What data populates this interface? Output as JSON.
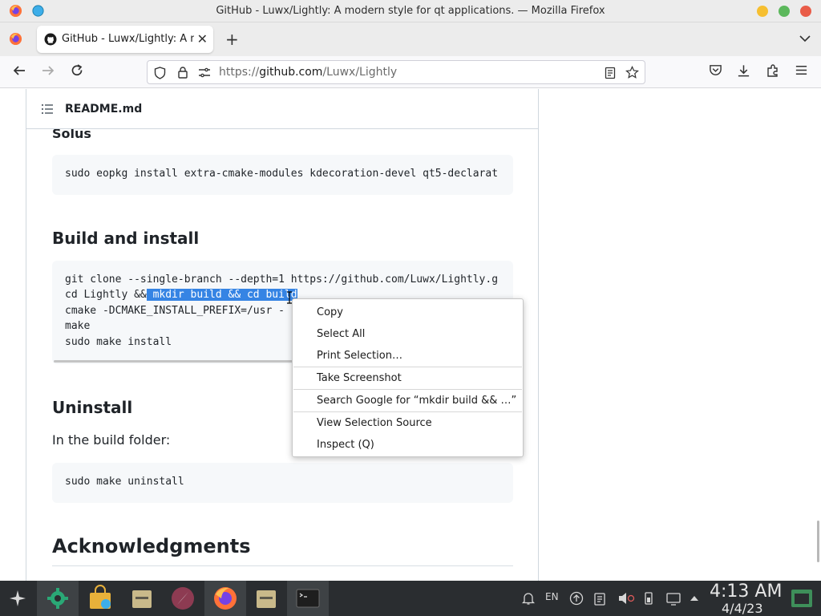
{
  "window": {
    "title": "GitHub - Luwx/Lightly: A modern style for qt applications. — Mozilla Firefox"
  },
  "tabs": [
    {
      "label": "GitHub - Luwx/Lightly: A m",
      "active": true
    }
  ],
  "navbar": {
    "url_prefix": "https://",
    "url_domain": "github.com",
    "url_path": "/Luwx/Lightly"
  },
  "readme": {
    "filename": "README.md",
    "solus_heading": "Solus",
    "solus_code": "sudo eopkg install extra-cmake-modules kdecoration-devel qt5-declarat",
    "build_heading": "Build and install",
    "build_code": {
      "line1": "git clone --single-branch --depth=1 https://github.com/Luwx/Lightly.g",
      "line2_pre": "cd Lightly &&",
      "line2_sel": " mkdir build && cd build",
      "line3": "cmake -DCMAKE_INSTALL_PREFIX=/usr -",
      "line4": "make",
      "line5": "sudo make install"
    },
    "uninstall_heading": "Uninstall",
    "uninstall_text": "In the build folder:",
    "uninstall_code": "sudo make uninstall",
    "ack_heading": "Acknowledgments"
  },
  "context_menu": {
    "items": [
      "Copy",
      "Select All",
      "Print Selection…",
      "Take Screenshot",
      "Search Google for “mkdir build && …”",
      "View Selection Source",
      "Inspect (Q)"
    ]
  },
  "taskbar": {
    "tray_lang": "EN",
    "time": "4:13 AM",
    "date": "4/4/23"
  },
  "colors": {
    "selection": "#3584e4",
    "taskbar_bg": "#2a2d30",
    "firefox_orange": "#ff7139"
  }
}
